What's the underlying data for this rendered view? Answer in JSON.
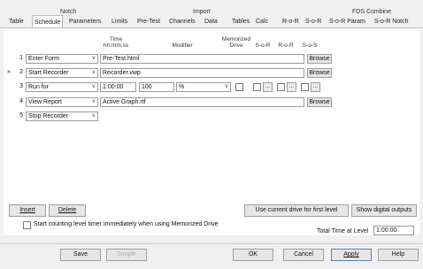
{
  "tab_groups": {
    "notch": "Notch",
    "import": "Import",
    "fds_combine": "FDS Combine"
  },
  "tabs": [
    {
      "label": "Table"
    },
    {
      "label": "Schedule"
    },
    {
      "label": "Parameters"
    },
    {
      "label": "Limits"
    },
    {
      "label": "Pre-Test"
    },
    {
      "label": "Channels"
    },
    {
      "label": "Data"
    },
    {
      "label": "Tables"
    },
    {
      "label": "Calc"
    },
    {
      "label": "R-o-R"
    },
    {
      "label": "S-o-R"
    },
    {
      "label": "S-o-R Param"
    },
    {
      "label": "S-o-R Notch"
    }
  ],
  "columns": {
    "time_line1": "Time",
    "time_line2": "hh:mm:ss",
    "modifier": "Modifier",
    "memorized_line1": "Memorized",
    "memorized_line2": "Drive",
    "sos1": "S-o-R",
    "ror": "R-o-R",
    "sos2": "S-o-S"
  },
  "rows": [
    {
      "num": "1",
      "marker": "",
      "action": "Enter Form",
      "value": "Pre-Test.html",
      "browse": "Browse"
    },
    {
      "num": "2",
      "marker": "»",
      "action": "Start Recorder",
      "value": "Recorder.vwp",
      "browse": "Browse"
    },
    {
      "num": "3",
      "marker": "",
      "action": "Run for",
      "time": "1:00:00",
      "amount": "100",
      "unit": "%",
      "dots": "..."
    },
    {
      "num": "4",
      "marker": "",
      "action": "View Report",
      "value": "Active Graph.rtf",
      "browse": "Browse"
    },
    {
      "num": "5",
      "marker": "",
      "action": "Stop Recorder",
      "value": ""
    }
  ],
  "buttons": {
    "insert": "Insert",
    "delete": "Delete",
    "use_current_drive": "Use current drive for first level",
    "show_digital": "Show digital outputs"
  },
  "checkbox_label": "Start counting level timer immediately when using Memorized Drive",
  "total_time_label": "Total Time at Level",
  "total_time_value": "1:00:00",
  "footer": {
    "save": "Save",
    "simple": "Simple",
    "ok": "OK",
    "cancel": "Cancel",
    "apply": "Apply",
    "help": "Help"
  }
}
